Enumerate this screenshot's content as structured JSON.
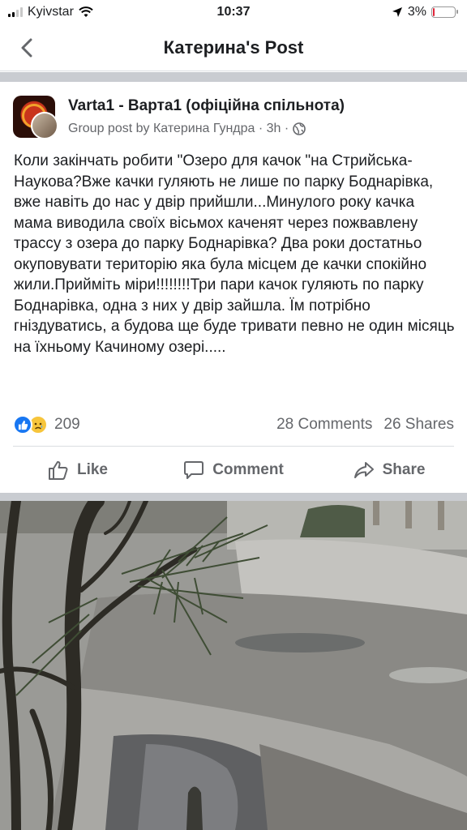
{
  "status_bar": {
    "carrier": "Kyivstar",
    "time": "10:37",
    "battery": "3%"
  },
  "header": {
    "title": "Катерина's Post"
  },
  "post": {
    "group_name": "Varta1 - Варта1 (офіційна спільнота)",
    "meta": "Group post by Катерина Гундра · 3h ·",
    "text": "Коли закінчать робити \"Озеро для качок \"на Стрийська-Наукова?Вже качки гуляють не лише по парку Боднарівка, вже навіть до нас у двір прийшли...Минулого року качка мама виводила своїх вісьмох каченят через пожвавлену трассу з озера до парку Боднарівка? Два роки достатньо окуповувати територію яка була місцем де качки спокійно жили.Прийміть міри!!!!!!!!Три пари качок гуляють по парку Боднарівка, одна з них у двір зайшла. Їм потрібно гніздуватись, а будова ще буде тривати певно не один місяць на їхньому Качиному озері.....",
    "reaction_count": "209",
    "comments": "28 Comments",
    "shares": "26 Shares"
  },
  "actions": {
    "like": "Like",
    "comment": "Comment",
    "share": "Share"
  },
  "icons": [
    "signal-icon",
    "wifi-icon",
    "location-arrow-icon",
    "battery-icon",
    "back-chevron-icon",
    "globe-icon",
    "like-reaction-icon",
    "sad-reaction-icon",
    "like-icon",
    "comment-icon",
    "share-icon"
  ],
  "colors": {
    "facebook_blue": "#1877f2",
    "secondary_text": "#65676b",
    "battery_low": "#e0263a"
  }
}
